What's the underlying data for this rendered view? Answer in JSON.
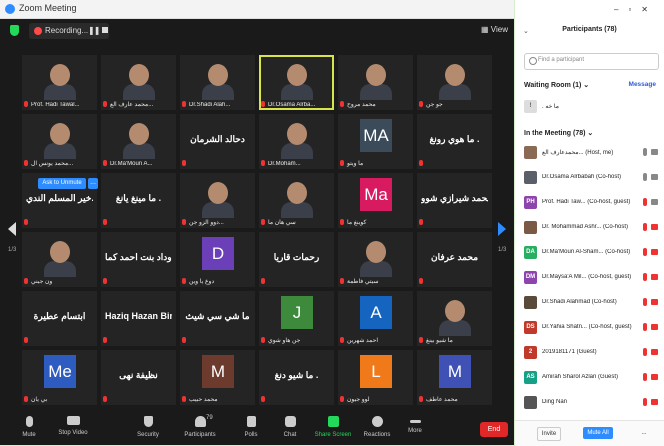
{
  "window": {
    "title": "Zoom Meeting"
  },
  "topbar": {
    "recording_label": "Recording...",
    "view_label": "View"
  },
  "pager": {
    "left": "1/3",
    "right": "1/3"
  },
  "tooltip": {
    "label": "Ask to Unmute",
    "more": "..."
  },
  "tiles": [
    {
      "name": "Prof. Hadi Tawal...",
      "type": "video"
    },
    {
      "name": "محمد عارف الع...",
      "type": "video"
    },
    {
      "name": "Dr.Shadi Alah...",
      "type": "video"
    },
    {
      "name": "Dr.Osama Alrba...",
      "type": "video",
      "active": true
    },
    {
      "name": "محمد مروح",
      "type": "video"
    },
    {
      "name": "جو جن",
      "type": "video"
    },
    {
      "name": "محمد يونس ال...",
      "type": "video"
    },
    {
      "name": "Dr.Ma'Moun A...",
      "type": "video"
    },
    {
      "name": "",
      "type": "text",
      "big": "دحالد الشرمان"
    },
    {
      "name": "Dr.Moham...",
      "type": "video"
    },
    {
      "name": "ما ويتو",
      "type": "avatar",
      "initials": "MA",
      "color": "#3b4b5a"
    },
    {
      "name": "",
      "type": "text",
      "big": "ما هوي رونغ ."
    },
    {
      "name": "",
      "type": "text",
      "big": "خير المسلم الندي..."
    },
    {
      "name": "",
      "type": "text",
      "big": "ما مينغ يانغ ."
    },
    {
      "name": "دوو الزو جن...",
      "type": "video"
    },
    {
      "name": "سي هان ما",
      "type": "video"
    },
    {
      "name": "كوينغ ما",
      "type": "avatar",
      "initials": "Ma",
      "color": "#d81b60"
    },
    {
      "name": "",
      "type": "text",
      "big": "محمد شيرازي شوو"
    },
    {
      "name": "ون جيني",
      "type": "video"
    },
    {
      "name": "",
      "type": "text",
      "big": "وداد بنت احمد كما..."
    },
    {
      "name": "دوغ يا وين",
      "type": "avatar",
      "initials": "D",
      "color": "#6a3fb8"
    },
    {
      "name": "",
      "type": "text",
      "big": "رحمات قاريا"
    },
    {
      "name": "سيتي فاطمة",
      "type": "video"
    },
    {
      "name": "",
      "type": "text",
      "big": "محمد عرفان"
    },
    {
      "name": "",
      "type": "text",
      "big": "ابتسام عطيرة"
    },
    {
      "name": "",
      "type": "text",
      "big": "Haziq Hazan Bin..."
    },
    {
      "name": "",
      "type": "text",
      "big": "ما شي سي شيث"
    },
    {
      "name": "جن هاو شوي",
      "type": "avatar",
      "initials": "J",
      "color": "#3d8a3d"
    },
    {
      "name": "احمد شهرين",
      "type": "avatar",
      "initials": "A",
      "color": "#1565c0"
    },
    {
      "name": "ما شيو بينغ",
      "type": "video"
    },
    {
      "name": "بي يان",
      "type": "avatar",
      "initials": "Me",
      "color": "#2e5bbf"
    },
    {
      "name": "",
      "type": "text",
      "big": "نظيفة نهى"
    },
    {
      "name": "محمد حبيب",
      "type": "avatar",
      "initials": "M",
      "color": "#6d3b2e"
    },
    {
      "name": "",
      "type": "text",
      "big": "ما شيو دنغ ."
    },
    {
      "name": "لوو جيون",
      "type": "avatar",
      "initials": "L",
      "color": "#f07a1a"
    },
    {
      "name": "محمد عاطف",
      "type": "avatar",
      "initials": "M",
      "color": "#3f51b5"
    }
  ],
  "toolbar": {
    "mute": "Mute",
    "stop_video": "Stop Video",
    "security": "Security",
    "participants": "Participants",
    "participants_count": "79",
    "polls": "Polls",
    "chat": "Chat",
    "share_screen": "Share Screen",
    "reactions": "Reactions",
    "more": "More",
    "end": "End"
  },
  "panel": {
    "title": "Participants (78)",
    "search_placeholder": "Find a participant",
    "waiting_room": "Waiting Room (1)",
    "message_label": "Message",
    "waiting_person": ". ما خه",
    "in_meeting": "In the Meeting (78)",
    "participants": [
      {
        "name": "محمدعارف الع... (Host, me)",
        "initials": "",
        "color": "#8a6a55",
        "mic": "on",
        "cam": "on"
      },
      {
        "name": "Dr.Osama Alrbabah (Co-host)",
        "initials": "",
        "color": "#5a5f6a",
        "mic": "on",
        "cam": "on"
      },
      {
        "name": "Prof. Hadi Taw... (Co-host, guest)",
        "initials": "PH",
        "color": "#8e44ad",
        "mic": "off",
        "cam": "on"
      },
      {
        "name": "Dr. Mohammad Ashr... (Co-host)",
        "initials": "",
        "color": "#7a5a44",
        "mic": "off",
        "cam": "off"
      },
      {
        "name": "Dr.Ma'Moun Al-Sham... (Co-host)",
        "initials": "DA",
        "color": "#27ae60",
        "mic": "off",
        "cam": "off"
      },
      {
        "name": "Dr.Maysa'A Mil... (Co-host, guest)",
        "initials": "DM",
        "color": "#8e44ad",
        "mic": "off",
        "cam": "off"
      },
      {
        "name": "Dr.Shadi Alahmad (Co-host)",
        "initials": "",
        "color": "#5a4a3a",
        "mic": "off",
        "cam": "off"
      },
      {
        "name": "Dr.Yahia Shatn... (Co-host, guest)",
        "initials": "DS",
        "color": "#c0392b",
        "mic": "off",
        "cam": "off"
      },
      {
        "name": "2019181171 (Guest)",
        "initials": "2",
        "color": "#c0392b",
        "mic": "off",
        "cam": "off"
      },
      {
        "name": "Amirah Sharol Azlan (Guest)",
        "initials": "AS",
        "color": "#16a085",
        "mic": "off",
        "cam": "off"
      },
      {
        "name": "Ding Nan",
        "initials": "",
        "color": "#555",
        "mic": "off",
        "cam": "off"
      }
    ],
    "invite": "Invite",
    "mute_all": "Mute All",
    "more": "..."
  }
}
